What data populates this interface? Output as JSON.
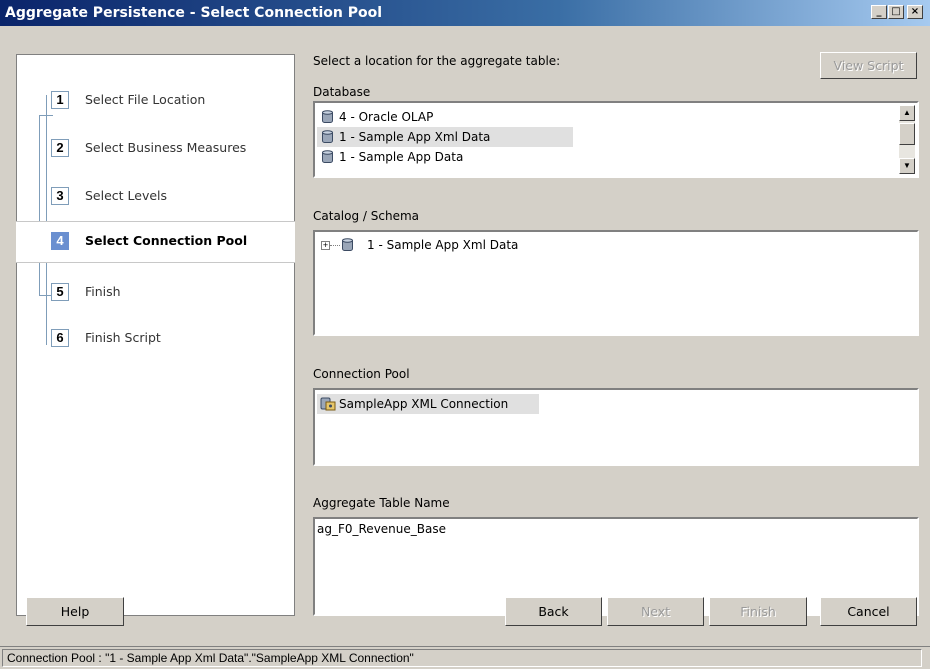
{
  "window": {
    "title": "Aggregate Persistence - Select Connection Pool"
  },
  "steps": [
    {
      "num": "1",
      "label": "Select File Location"
    },
    {
      "num": "2",
      "label": "Select Business Measures"
    },
    {
      "num": "3",
      "label": "Select Levels"
    },
    {
      "num": "4",
      "label": "Select Connection Pool"
    },
    {
      "num": "5",
      "label": "Finish"
    },
    {
      "num": "6",
      "label": "Finish Script"
    }
  ],
  "main": {
    "instruction": "Select a location for the aggregate table:",
    "view_script_label": "View Script",
    "database_label": "Database",
    "databases": [
      "4 - Oracle OLAP",
      "1 - Sample App Xml Data",
      "1 - Sample App Data"
    ],
    "catalog_label": "Catalog / Schema",
    "catalog_item": "1 - Sample App Xml Data",
    "connection_pool_label": "Connection Pool",
    "connection_pool_item": "SampleApp XML Connection",
    "aggregate_name_label": "Aggregate Table Name",
    "aggregate_name_value": "ag_F0_Revenue_Base"
  },
  "buttons": {
    "help": "Help",
    "back": "Back",
    "next": "Next",
    "finish": "Finish",
    "cancel": "Cancel"
  },
  "status": {
    "text": "Connection Pool : \"1 - Sample App Xml Data\".\"SampleApp XML Connection\""
  },
  "colors": {
    "active_step": "#6a8fd0",
    "title_bar": "#0a246a"
  }
}
